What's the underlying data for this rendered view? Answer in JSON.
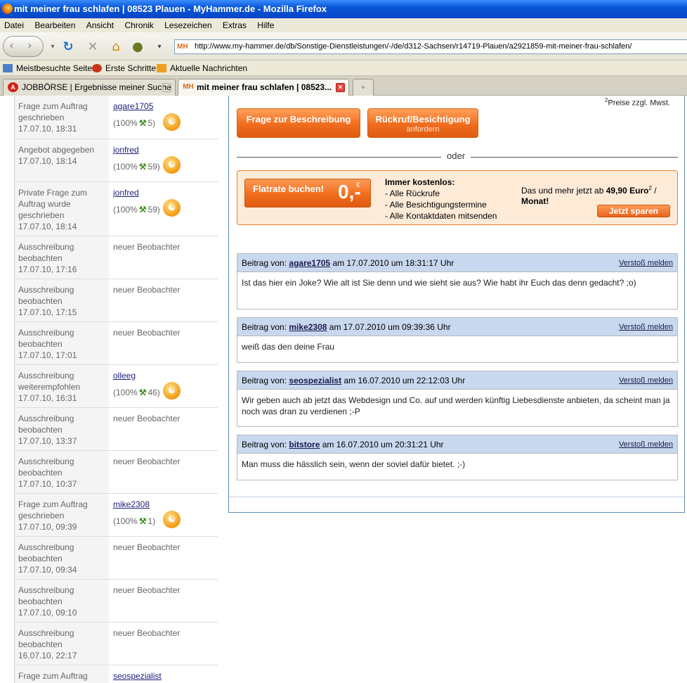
{
  "window": {
    "title": "mit meiner frau schlafen | 08523 Plauen - MyHammer.de - Mozilla Firefox"
  },
  "menu": [
    "Datei",
    "Bearbeiten",
    "Ansicht",
    "Chronik",
    "Lesezeichen",
    "Extras",
    "Hilfe"
  ],
  "nav": {
    "url": "http://www.my-hammer.de/db/Sonstige-Dienstleistungen/-/de/d312-Sachsen/r14719-Plauen/a2921859-mit-meiner-frau-schlafen/",
    "site_badge": "MH"
  },
  "bookmarks": [
    "Meistbesuchte Seiten",
    "Erste Schritte",
    "Aktuelle Nachrichten"
  ],
  "tabs": [
    {
      "label": "JOBBÖRSE | Ergebnisse meiner Suche",
      "icon": "A"
    },
    {
      "label": "mit meiner frau schlafen | 08523...",
      "icon": "MH"
    }
  ],
  "activity": [
    {
      "action": "Frage zum Auftrag geschrieben",
      "date": "17.07.10, 18:31",
      "user": "agare1705",
      "rating": "(100%",
      "count": "5)"
    },
    {
      "action": "Angebot abgegeben",
      "date": "17.07.10, 18:14",
      "user": "jonfred",
      "rating": "(100%",
      "count": "59)"
    },
    {
      "action": "Private Frage zum Auftrag wurde geschrieben",
      "date": "17.07.10, 18:14",
      "user": "jonfred",
      "rating": "(100%",
      "count": "59)"
    },
    {
      "action": "Ausschreibung beobachten",
      "date": "17.07.10, 17:16",
      "note": "neuer Beobachter"
    },
    {
      "action": "Ausschreibung beobachten",
      "date": "17.07.10, 17:15",
      "note": "neuer Beobachter"
    },
    {
      "action": "Ausschreibung beobachten",
      "date": "17.07.10, 17:01",
      "note": "neuer Beobachter"
    },
    {
      "action": "Ausschreibung weiterempfohlen",
      "date": "17.07.10, 16:31",
      "user": "olleeg",
      "rating": "(100%",
      "count": "46)"
    },
    {
      "action": "Ausschreibung beobachten",
      "date": "17.07.10, 13:37",
      "note": "neuer Beobachter"
    },
    {
      "action": "Ausschreibung beobachten",
      "date": "17.07.10, 10:37",
      "note": "neuer Beobachter"
    },
    {
      "action": "Frage zum Auftrag geschrieben",
      "date": "17.07.10, 09:39",
      "user": "mike2308",
      "rating": "(100%",
      "count": "1)"
    },
    {
      "action": "Ausschreibung beobachten",
      "date": "17.07.10, 09:34",
      "note": "neuer Beobachter"
    },
    {
      "action": "Ausschreibung beobachten",
      "date": "17.07.10, 09:10",
      "note": "neuer Beobachter"
    },
    {
      "action": "Ausschreibung beobachten",
      "date": "16.07.10, 22:17",
      "note": "neuer Beobachter"
    },
    {
      "action": "Frage zum Auftrag",
      "date": "",
      "user": "seospezialist"
    }
  ],
  "main": {
    "price_note_sup": "2",
    "price_note": "Preise zzgl. Mwst.",
    "btn_question": "Frage zur Beschreibung",
    "btn_callback": "Rückruf/Besichtigung",
    "btn_callback_sub": "anfordern",
    "or": "oder",
    "flatrate": {
      "button": "Flatrate buchen!",
      "price": "0,-",
      "currency": "€",
      "free_title": "Immer kostenlos:",
      "free_items": [
        "- Alle Rückrufe",
        "- Alle Besichtigungstermine",
        "- Alle Kontaktdaten mitsenden"
      ],
      "offer_pre": "Das und mehr jetzt ab",
      "offer_price": "49,90 Euro",
      "offer_sup": "2",
      "offer_post": " /",
      "offer_period": "Monat!",
      "save_button": "Jetzt sparen"
    }
  },
  "posts": [
    {
      "prefix": "Beitrag von:",
      "author": "agare1705",
      "date": "am 17.07.2010 um 18:31:17 Uhr",
      "report": "Verstoß melden",
      "text": "Ist das hier ein Joke? Wie alt ist Sie denn und wie sieht sie aus? Wie habt ihr Euch das denn gedacht? ;o)"
    },
    {
      "prefix": "Beitrag von:",
      "author": "mike2308",
      "date": "am 17.07.2010 um 09:39:36 Uhr",
      "report": "Verstoß melden",
      "text": "weiß das den deine Frau"
    },
    {
      "prefix": "Beitrag von:",
      "author": "seospezialist",
      "date": "am 16.07.2010 um 22:12:03 Uhr",
      "report": "Verstoß melden",
      "text": "Wir geben auch ab jetzt das Webdesign und Co. auf und werden künftig Liebesdienste anbieten, da scheint man ja noch was dran zu verdienen ;-P"
    },
    {
      "prefix": "Beitrag von:",
      "author": "bitstore",
      "date": "am 16.07.2010 um 20:31:21 Uhr",
      "report": "Verstoß melden",
      "text": "Man muss die hässlich sein, wenn der soviel dafür bietet. ;-)"
    }
  ]
}
